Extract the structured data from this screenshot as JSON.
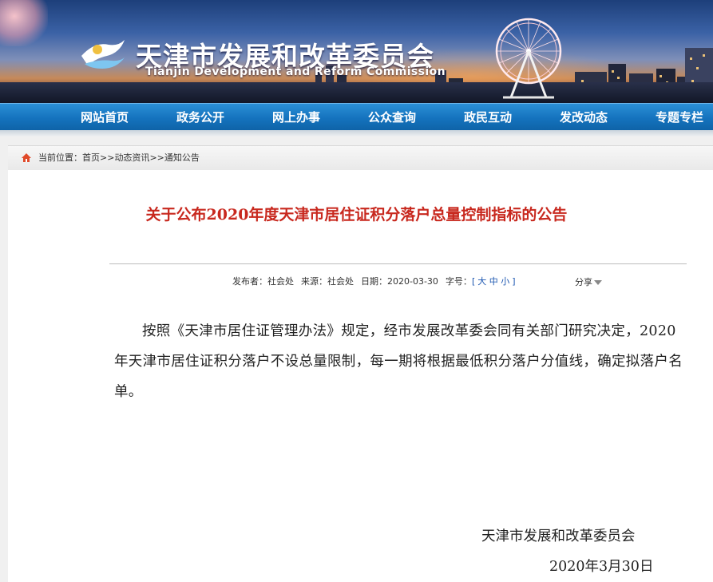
{
  "header": {
    "title_cn": "天津市发展和改革委员会",
    "title_en": "Tianjin Development and Reform Commission"
  },
  "nav": {
    "items": [
      {
        "label": "网站首页"
      },
      {
        "label": "政务公开"
      },
      {
        "label": "网上办事"
      },
      {
        "label": "公众查询"
      },
      {
        "label": "政民互动"
      },
      {
        "label": "发改动态"
      },
      {
        "label": "专题专栏"
      }
    ]
  },
  "breadcrumb": {
    "prefix": "当前位置：",
    "items": [
      "首页",
      "动态资讯",
      "通知公告"
    ],
    "separator": ">>"
  },
  "article": {
    "title": "关于公布2020年度天津市居住证积分落户总量控制指标的公告",
    "publisher_label": "发布者：",
    "publisher": "社会处",
    "source_label": "来源：",
    "source": "社会处",
    "date_label": "日期：",
    "date": "2020-03-30",
    "fontsize_label": "字号：",
    "fontsize_open": "[",
    "fontsize_large": "大",
    "fontsize_medium": "中",
    "fontsize_small": "小",
    "fontsize_close": "]",
    "share_label": "分享",
    "body": "按照《天津市居住证管理办法》规定，经市发展改革委会同有关部门研究决定，2020年天津市居住证积分落户不设总量限制，每一期将根据最低积分落户分值线，确定拟落户名单。",
    "signature_org": "天津市发展和改革委员会",
    "signature_date": "2020年3月30日"
  },
  "colors": {
    "nav_blue": "#1472bd",
    "title_red": "#c8281e",
    "font_size_link": "#1a55b0"
  }
}
